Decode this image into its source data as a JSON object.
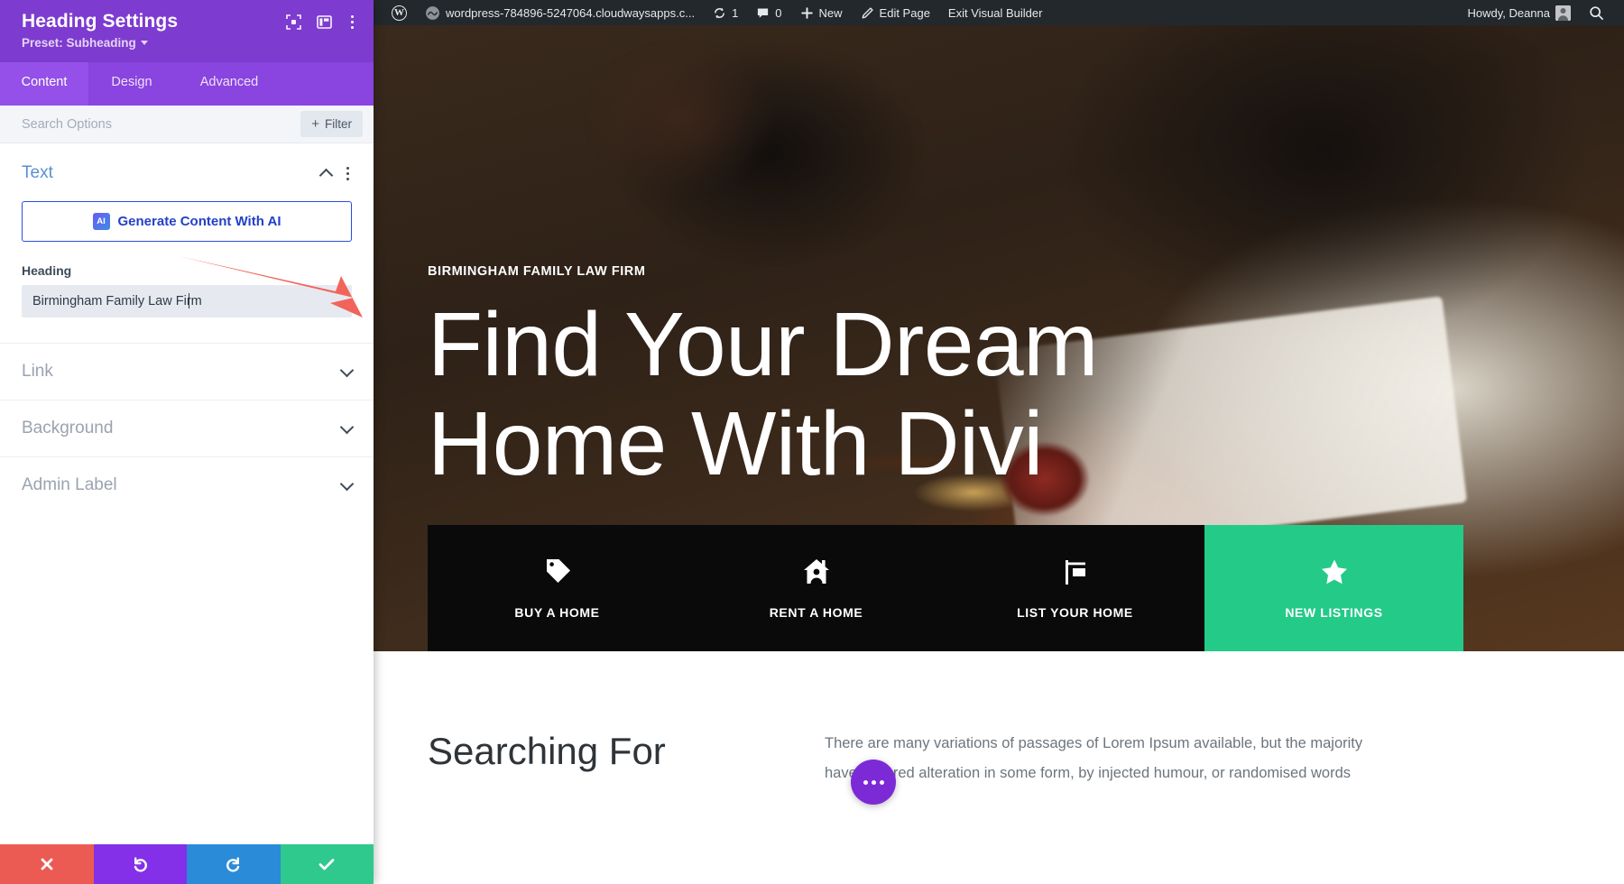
{
  "settings_panel": {
    "title": "Heading Settings",
    "preset_label": "Preset: Subheading",
    "icons": {
      "focus": "focus-frame-icon",
      "layout": "panel-layout-icon",
      "more": "kebab-menu-icon"
    },
    "tabs": [
      {
        "label": "Content",
        "active": true
      },
      {
        "label": "Design",
        "active": false
      },
      {
        "label": "Advanced",
        "active": false
      }
    ],
    "search": {
      "placeholder": "Search Options",
      "value": ""
    },
    "filter_button": {
      "label": "Filter",
      "plus": "+"
    },
    "text_section": {
      "title": "Text",
      "ai_button_label": "Generate Content With AI",
      "ai_badge": "AI",
      "heading_field": {
        "label": "Heading",
        "value": "Birmingham Family Law Firm"
      }
    },
    "collapsed_sections": [
      {
        "label": "Link"
      },
      {
        "label": "Background"
      },
      {
        "label": "Admin Label"
      }
    ],
    "actions": [
      {
        "name": "discard",
        "glyph": "✖",
        "color": "#eb5b53"
      },
      {
        "name": "undo",
        "glyph": "↺",
        "color": "#8330e8"
      },
      {
        "name": "redo",
        "glyph": "↻",
        "color": "#2a8bd8"
      },
      {
        "name": "save",
        "glyph": "✔",
        "color": "#30c98d"
      }
    ]
  },
  "admin_bar": {
    "wp_logo": "wordpress-logo-icon",
    "site_name": "wordpress-784896-5247064.cloudwaysapps.c...",
    "updates": {
      "icon": "updates-icon",
      "count": "1"
    },
    "comments": {
      "icon": "comment-bubble-icon",
      "count": "0"
    },
    "new_label": "New",
    "edit_page_label": "Edit Page",
    "exit_builder_label": "Exit Visual Builder",
    "howdy": "Howdy, Deanna",
    "search_icon": "search-icon"
  },
  "hero": {
    "subheading": "BIRMINGHAM FAMILY LAW FIRM",
    "title_line1": "Find Your Dream",
    "title_line2": "Home With Divi"
  },
  "feature_bar": [
    {
      "label": "BUY A HOME",
      "icon": "price-tag-icon",
      "accent": false
    },
    {
      "label": "RENT A HOME",
      "icon": "house-person-icon",
      "accent": false
    },
    {
      "label": "LIST YOUR HOME",
      "icon": "yard-sign-icon",
      "accent": false
    },
    {
      "label": "NEW LISTINGS",
      "icon": "star-icon",
      "accent": true
    }
  ],
  "lower_section": {
    "heading": "Searching For",
    "paragraph": "There are many variations of passages of Lorem Ipsum available, but the majority have suffered alteration in some form, by injected humour, or randomised words"
  },
  "floating_button": {
    "name": "divi-menu-fab",
    "icon": "ellipsis-icon"
  },
  "colors": {
    "panel_purple": "#7e3bd0",
    "tab_purple": "#8a44df",
    "accent_green": "#24ca88",
    "ai_blue": "#2340c8",
    "admin_dark": "#23282d",
    "annotation_red": "#f2645a"
  }
}
